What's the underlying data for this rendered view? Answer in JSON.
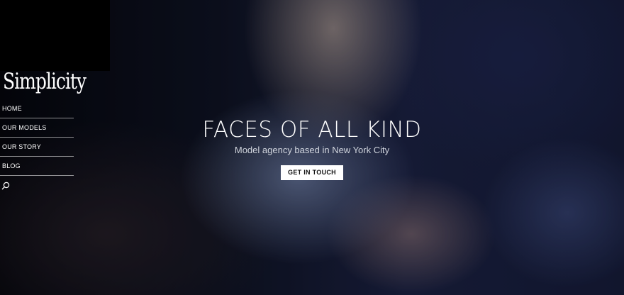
{
  "brand": {
    "logo_text": "Simplicity"
  },
  "nav": {
    "items": [
      {
        "label": "HOME"
      },
      {
        "label": "OUR MODELS"
      },
      {
        "label": "OUR STORY"
      },
      {
        "label": "BLOG"
      }
    ],
    "search_icon": "search-icon"
  },
  "hero": {
    "title": "FACES OF ALL KIND",
    "subtitle": "Model agency based in New York City",
    "cta_label": "GET IN TOUCH"
  },
  "colors": {
    "text": "#ffffff",
    "cta_background": "#ffffff",
    "cta_text": "#111111"
  }
}
